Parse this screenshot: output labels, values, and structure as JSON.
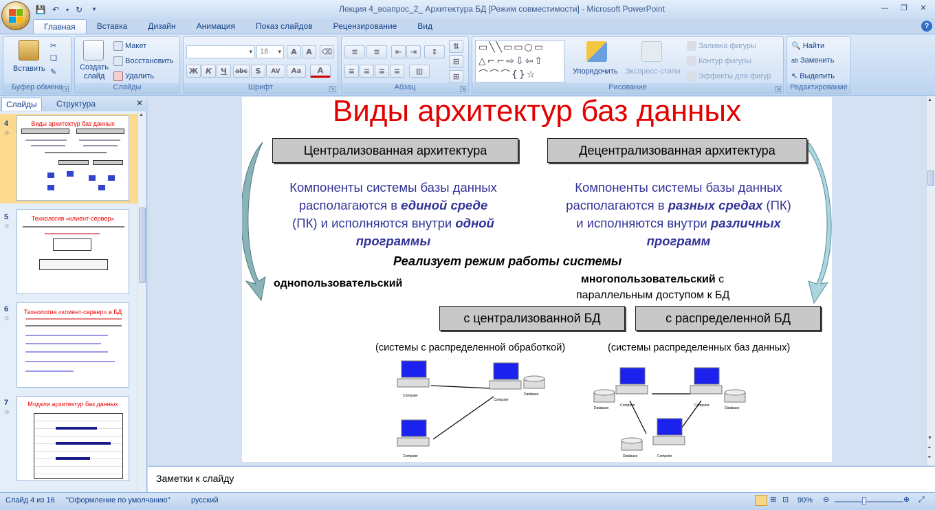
{
  "window": {
    "title": "Лекция 4_воапрос_2_ Архитектура БД  [Режим совместимости] - Microsoft PowerPoint"
  },
  "ribbon_tabs": [
    "Главная",
    "Вставка",
    "Дизайн",
    "Анимация",
    "Показ слайдов",
    "Рецензирование",
    "Вид"
  ],
  "ribbon": {
    "clipboard": {
      "paste": "Вставить",
      "label": "Буфер обмена"
    },
    "slides": {
      "new_slide": "Создать слайд",
      "layout": "Макет",
      "reset": "Восстановить",
      "delete": "Удалить",
      "label": "Слайды"
    },
    "font": {
      "size": "18",
      "label": "Шрифт"
    },
    "paragraph": {
      "label": "Абзац"
    },
    "drawing": {
      "arrange": "Упорядочить",
      "quick_styles": "Экспресс-стили",
      "fill": "Заливка фигуры",
      "outline": "Контур фигуры",
      "effects": "Эффекты для фигур",
      "label": "Рисование"
    },
    "editing": {
      "find": "Найти",
      "replace": "Заменить",
      "select": "Выделить",
      "label": "Редактирование"
    }
  },
  "left_panel": {
    "tab_slides": "Слайды",
    "tab_outline": "Структура",
    "thumbs": [
      {
        "num": "4",
        "title": "Виды архитектур баз данных"
      },
      {
        "num": "5",
        "title": "Технология «клиент-сервер»"
      },
      {
        "num": "6",
        "title": "Технология «клиент-сервер» в БД"
      },
      {
        "num": "7",
        "title": "Модели архитектур баз данных"
      }
    ]
  },
  "slide": {
    "title": "Виды архитектур баз данных",
    "box_central": "Централизованная архитектура",
    "box_decentral": "Децентрализованная архитектура",
    "left_text_1": "Компоненты системы базы данных",
    "left_text_2a": "располагаются в ",
    "left_text_2b": "единой среде",
    "left_text_3a": "(ПК) и исполняются внутри ",
    "left_text_3b": "одной",
    "left_text_4": "программы",
    "right_text_1": "Компоненты системы базы данных",
    "right_text_2a": "располагаются в ",
    "right_text_2b": "разных средах",
    "right_text_2c": " (ПК)",
    "right_text_3a": "и исполняются внутри ",
    "right_text_3b": "различных",
    "right_text_4": "программ",
    "mode": "Реализует режим работы системы",
    "single_user": "однопользовательский",
    "multi_user_a": "многопользовательский",
    "multi_user_b": " с",
    "multi_user_c": "параллельным доступом к БД",
    "box_central_db": "с централизованной БД",
    "box_distributed_db": "с распределенной БД",
    "caption_left": "(системы с распределенной обработкой)",
    "caption_right": "(системы распределенных баз данных)",
    "pc_label": "Computer",
    "db_label": "Database"
  },
  "notes": "Заметки к слайду",
  "status": {
    "slide": "Слайд 4 из 16",
    "theme": "\"Оформление по умолчанию\"",
    "lang": "русский",
    "zoom": "90%"
  },
  "colors": {
    "title_red": "#e30000",
    "body_blue": "#333399",
    "box_gray": "#c8c8c8"
  }
}
